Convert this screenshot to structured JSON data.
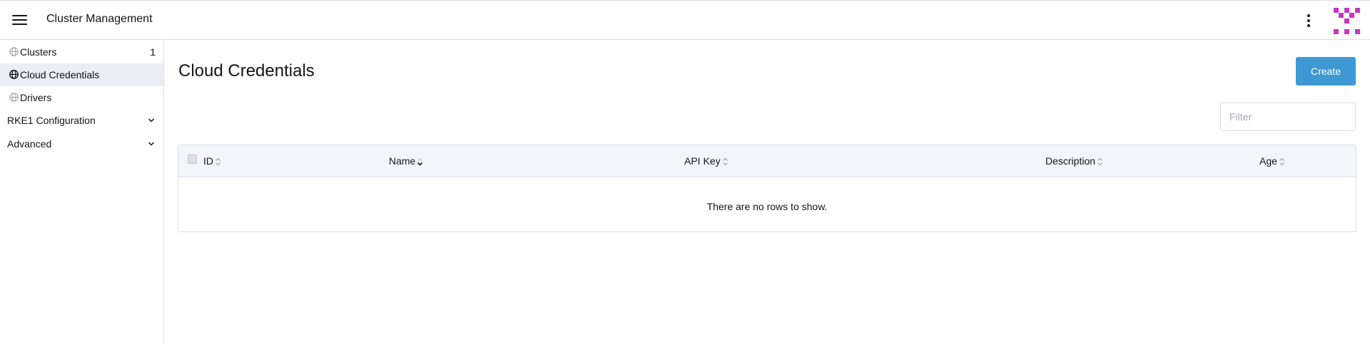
{
  "header": {
    "title": "Cluster Management"
  },
  "sidebar": {
    "items": [
      {
        "label": "Clusters",
        "count": "1"
      },
      {
        "label": "Cloud Credentials"
      },
      {
        "label": "Drivers"
      }
    ],
    "groups": [
      {
        "label": "RKE1 Configuration"
      },
      {
        "label": "Advanced"
      }
    ]
  },
  "main": {
    "title": "Cloud Credentials",
    "create_label": "Create",
    "filter_placeholder": "Filter",
    "table": {
      "columns": [
        "ID",
        "Name",
        "API Key",
        "Description",
        "Age"
      ],
      "empty_message": "There are no rows to show."
    }
  },
  "colors": {
    "accent": "#3d98d3",
    "avatar": "#c436c4",
    "active_bg": "#ebedf3"
  }
}
